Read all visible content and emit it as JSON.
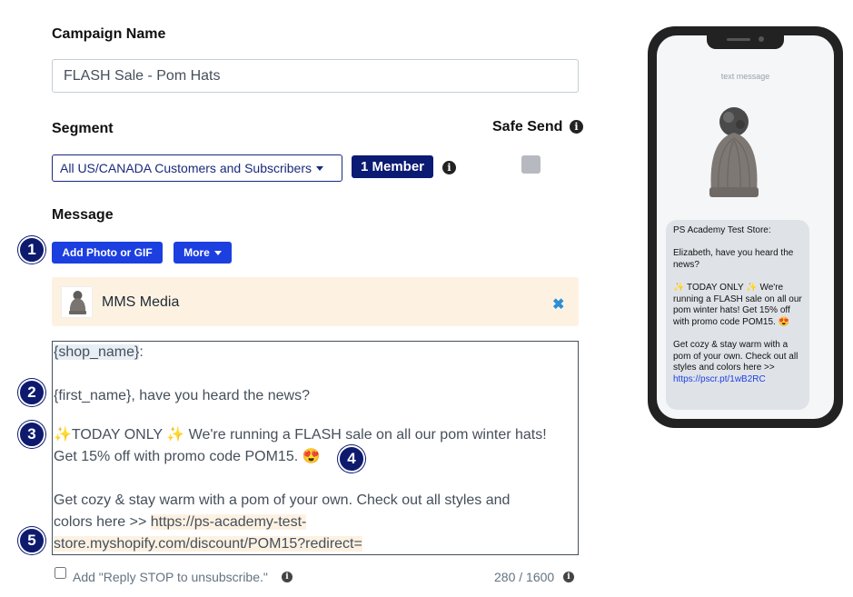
{
  "campaign": {
    "label": "Campaign Name",
    "value": "FLASH Sale - Pom Hats"
  },
  "segment": {
    "label": "Segment",
    "selected": "All US/CANADA Customers and Subscribers",
    "member_badge": "1 Member"
  },
  "safe_send": {
    "label": "Safe Send"
  },
  "message": {
    "label": "Message",
    "add_photo_label": "Add Photo or GIF",
    "more_label": "More",
    "mms_label": "MMS Media",
    "lines": {
      "l1": "{shop_name}",
      "l1_suffix": ":",
      "l2": "{first_name}, have you heard the news?",
      "l3": "✨TODAY ONLY ✨ We're running a FLASH sale on all our pom winter hats!",
      "l4": "Get 15% off with promo code POM15. 😍",
      "l5": "Get cozy & stay warm with a pom of your own. Check out all styles and",
      "l6_prefix": "colors here >> ",
      "l6_link": "https://ps-academy-test-",
      "l7_link": "store.myshopify.com/discount/POM15?redirect="
    }
  },
  "footer": {
    "reply_stop_label": "Add \"Reply STOP to unsubscribe.\"",
    "char_count": "280 / 1600"
  },
  "steps": [
    "1",
    "2",
    "3",
    "4",
    "5"
  ],
  "phone": {
    "header": "text message",
    "bubble": {
      "store": "PS Academy Test Store:",
      "greeting": "Elizabeth, have you heard the news?",
      "promo": "✨ TODAY ONLY ✨ We're running a FLASH sale on all our pom winter hats! Get 15% off with promo code POM15. 😍",
      "cozy": "Get cozy & stay warm with a pom of your own. Check out all styles and colors here >>",
      "link": "https://pscr.pt/1wB2RC"
    }
  },
  "colors": {
    "primary": "#1c3fe0",
    "navy": "#0b1a72",
    "mms_bg": "#fdf2e2"
  }
}
